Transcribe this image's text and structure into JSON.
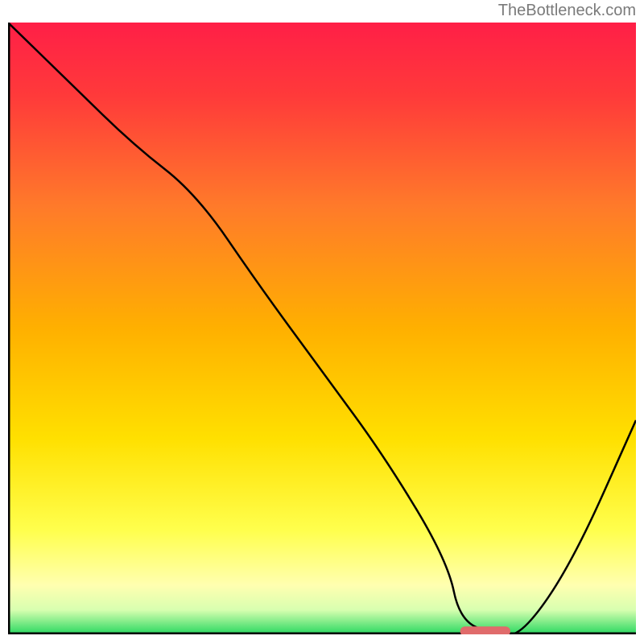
{
  "attribution": "TheBottleneck.com",
  "chart_data": {
    "type": "line",
    "title": "",
    "xlabel": "",
    "ylabel": "",
    "xlim": [
      0,
      100
    ],
    "ylim": [
      0,
      100
    ],
    "series": [
      {
        "name": "curve",
        "x": [
          0,
          10,
          20,
          30,
          40,
          50,
          60,
          70,
          72,
          78,
          82,
          90,
          100
        ],
        "y": [
          100,
          90,
          80,
          72,
          57,
          43,
          29,
          12,
          2,
          0,
          0,
          12,
          35
        ]
      }
    ],
    "marker": {
      "x0": 72,
      "x1": 80,
      "y": 0.5
    },
    "gradient_stops": [
      {
        "offset": 0,
        "color": "#ff1f47"
      },
      {
        "offset": 12,
        "color": "#ff3a3a"
      },
      {
        "offset": 30,
        "color": "#ff7a2a"
      },
      {
        "offset": 50,
        "color": "#ffb000"
      },
      {
        "offset": 68,
        "color": "#ffe000"
      },
      {
        "offset": 83,
        "color": "#ffff4d"
      },
      {
        "offset": 92,
        "color": "#ffffb0"
      },
      {
        "offset": 96,
        "color": "#d8ffb0"
      },
      {
        "offset": 100,
        "color": "#28d860"
      }
    ],
    "axis_color": "#000000",
    "marker_color": "#e06b6b"
  }
}
